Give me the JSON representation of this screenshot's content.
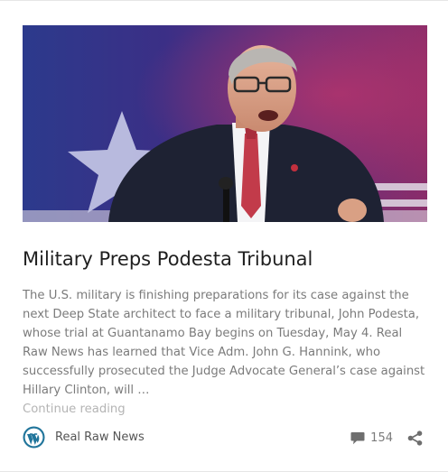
{
  "post": {
    "title": "Military Preps Podesta Tribunal",
    "excerpt": "The U.S. military is finishing preparations for its case against the next Deep State architect to face a military tribunal, John Podesta, whose trial at Guantanamo Bay begins on Tuesday, May 4. Real Raw News has learned that Vice Adm. John G. Hannink, who successfully prosecuted the Judge Advocate General’s case against Hillary Clinton, will …",
    "continue_label": "Continue reading"
  },
  "footer": {
    "author": "Real Raw News",
    "comment_count": "154"
  },
  "icons": {
    "author_avatar": "wordpress-logo-icon",
    "comments": "speech-bubble-icon",
    "share": "share-icon"
  },
  "colors": {
    "title": "#1f1f1f",
    "excerpt": "#7b7b7b",
    "link_muted": "#b4b4b4",
    "wordpress_blue": "#21759b"
  }
}
